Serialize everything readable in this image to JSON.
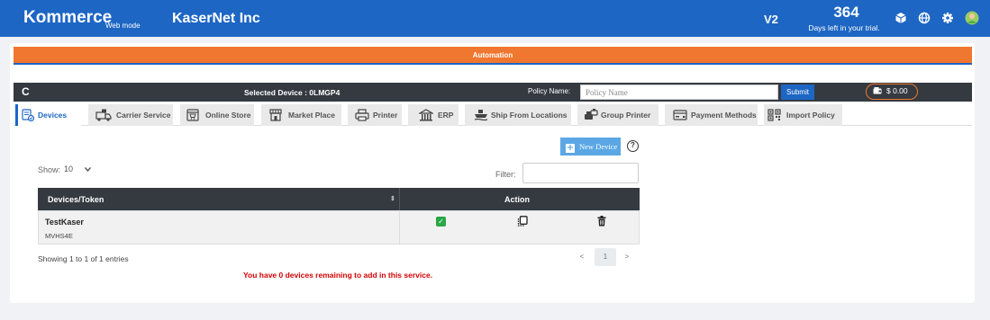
{
  "topbar": {
    "brand": "Kommerce",
    "mode": "Web mode",
    "company": "KaserNet Inc",
    "version": "V2",
    "trial_days": "364",
    "trial_text": "Days left in your trial.",
    "icons": [
      "cube-icon",
      "globe-icon",
      "gear-icon",
      "user-avatar-icon"
    ]
  },
  "banner": {
    "label": "Automation"
  },
  "device_bar": {
    "refresh_icon": "C",
    "selected_device": "Selected Device : 0LMGP4",
    "policy_label": "Policy Name:",
    "policy_placeholder": "Policy Name",
    "submit_label": "Submit",
    "balance": "$ 0.00"
  },
  "tabs": [
    {
      "label": "Devices",
      "icon": "devices-icon",
      "active": true
    },
    {
      "label": "Carrier Service",
      "icon": "truck-icon"
    },
    {
      "label": "Online Store",
      "icon": "store-icon"
    },
    {
      "label": "Market Place",
      "icon": "market-icon"
    },
    {
      "label": "Printer",
      "icon": "printer-icon"
    },
    {
      "label": "ERP",
      "icon": "erp-icon"
    },
    {
      "label": "Ship From Locations",
      "icon": "ship-icon"
    },
    {
      "label": "Group Printer",
      "icon": "group-printer-icon"
    },
    {
      "label": "Payment Methods",
      "icon": "payment-icon"
    },
    {
      "label": "Import Policy",
      "icon": "import-icon"
    }
  ],
  "toolbar": {
    "new_device_label": "New Device",
    "help_icon": "?"
  },
  "table_controls": {
    "show_label": "Show:",
    "show_value": "10",
    "filter_label": "Filter:"
  },
  "table": {
    "headers": [
      "Devices/Token",
      "Action"
    ],
    "rows": [
      {
        "name": "TestKaser",
        "token": "MVHS4E",
        "actions": [
          "check-icon",
          "copy-icon",
          "trash-icon"
        ]
      }
    ]
  },
  "footer": {
    "entries": "Showing 1 to 1 of 1 entries",
    "warning": "You have 0 devices remaining to add in this service.",
    "pagination": {
      "prev": "<",
      "current": "1",
      "next": ">"
    }
  },
  "colors": {
    "primary": "#1d66c4",
    "accent": "#f0772f",
    "dark": "#343a40",
    "success": "#28a745",
    "danger": "#d40000"
  }
}
